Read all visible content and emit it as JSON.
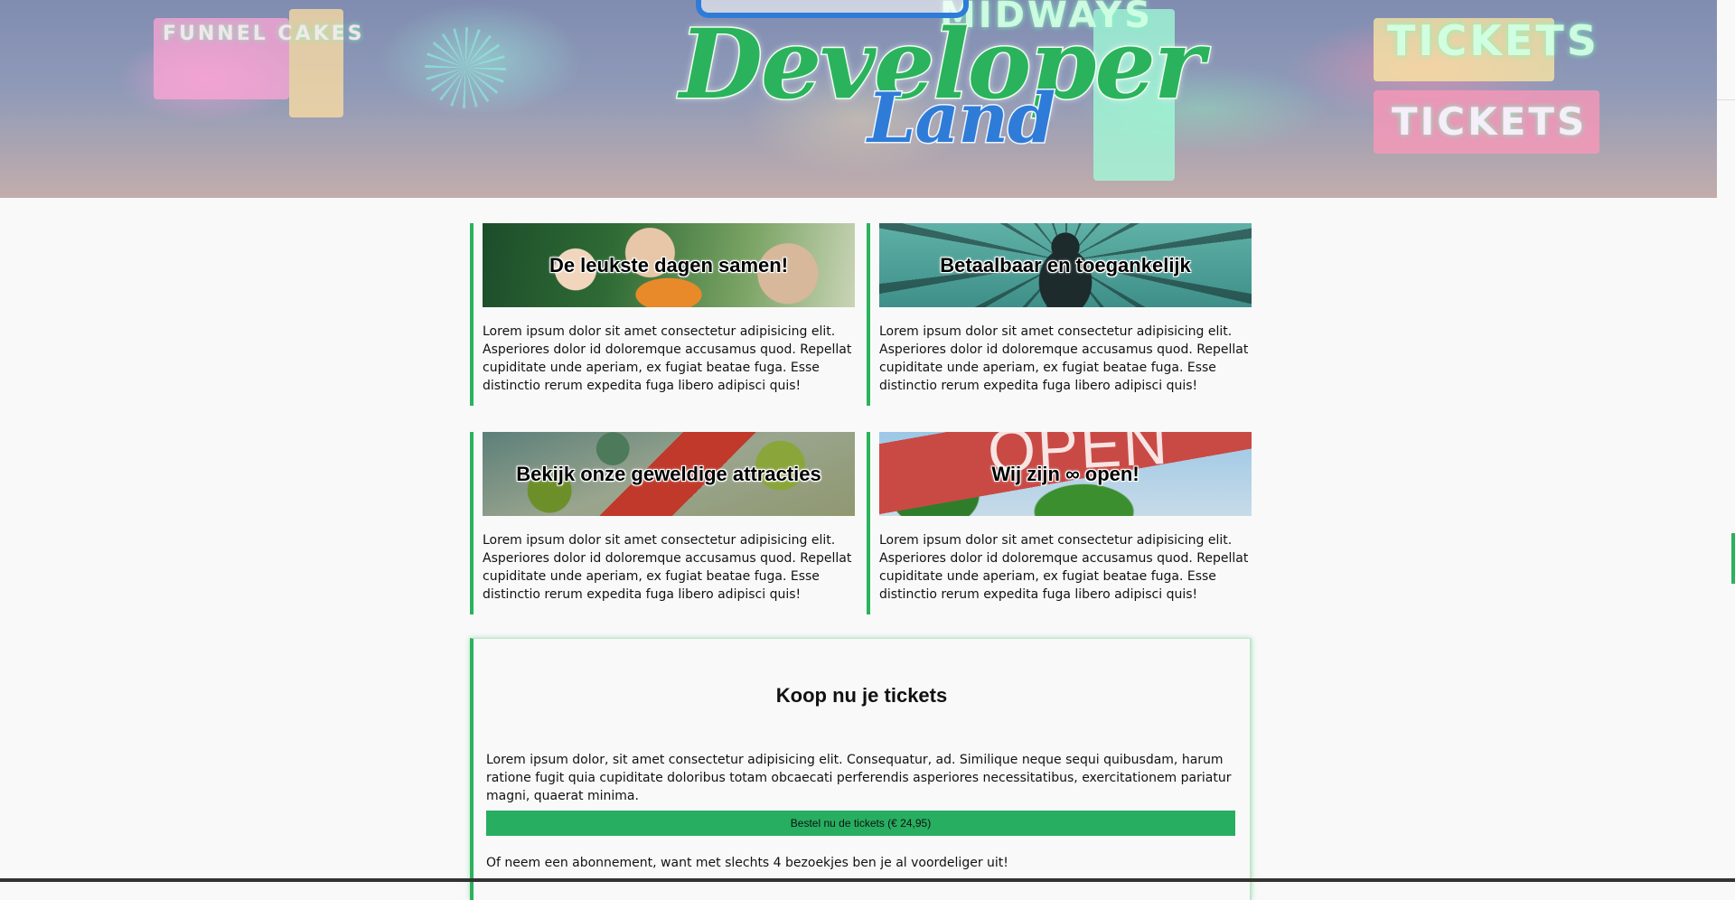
{
  "hero": {
    "logo_line1": "Developer",
    "logo_line2": "Land",
    "signs": [
      "TICKETS",
      "TICKETS",
      "FUNNEL CAKES",
      "MIDWAYS"
    ]
  },
  "cards": [
    {
      "title": "De leukste dagen samen!",
      "text": "Lorem ipsum dolor sit amet consectetur adipisicing elit. Asperiores dolor id doloremque accusamus quod. Repellat cupiditate unde aperiam, ex fugiat beatae fuga. Esse distinctio rerum expedita fuga libero adipisci quis!"
    },
    {
      "title": "Betaalbaar en toegankelijk",
      "text": "Lorem ipsum dolor sit amet consectetur adipisicing elit. Asperiores dolor id doloremque accusamus quod. Repellat cupiditate unde aperiam, ex fugiat beatae fuga. Esse distinctio rerum expedita fuga libero adipisci quis!"
    },
    {
      "title": "Bekijk onze geweldige attracties",
      "text": "Lorem ipsum dolor sit amet consectetur adipisicing elit. Asperiores dolor id doloremque accusamus quod. Repellat cupiditate unde aperiam, ex fugiat beatae fuga. Esse distinctio rerum expedita fuga libero adipisci quis!"
    },
    {
      "title": "Wij zijn ∞ open!",
      "image_text": "OPEN",
      "text": "Lorem ipsum dolor sit amet consectetur adipisicing elit. Asperiores dolor id doloremque accusamus quod. Repellat cupiditate unde aperiam, ex fugiat beatae fuga. Esse distinctio rerum expedita fuga libero adipisci quis!"
    }
  ],
  "tickets": {
    "title": "Koop nu je tickets",
    "text": "Lorem ipsum dolor, sit amet consectetur adipisicing elit. Consequatur, ad. Similique neque sequi quibusdam, harum ratione fugit quia cupiditate doloribus totam obcaecati perferendis asperiores necessitatibus, exercitationem pariatur magni, quaerat minima.",
    "button_label": "Bestel nu de tickets (€ 24,95)",
    "note": "Of neem een abonnement, want met slechts 4 bezoekjes ben je al voordeliger uit!"
  },
  "colors": {
    "accent": "#2ab35c",
    "button": "#27ae60",
    "logo_blue": "#2f7cd8",
    "background": "#f9f9f9"
  }
}
